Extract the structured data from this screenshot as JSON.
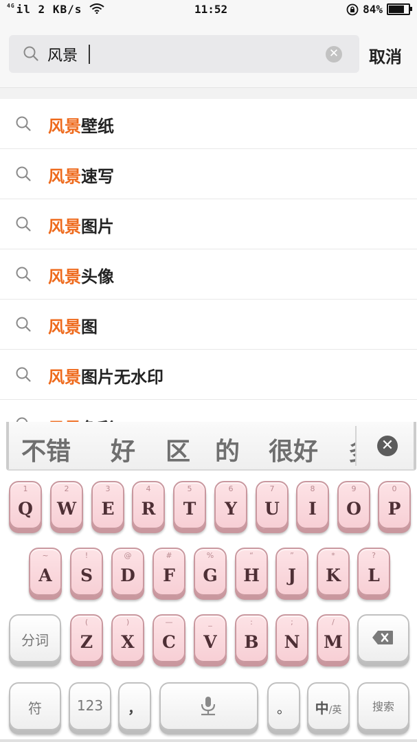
{
  "status_bar": {
    "network_type": "4G",
    "signal": "il",
    "speed": "2 KB/s",
    "time": "11:52",
    "battery": "84%",
    "battery_level": 0.84
  },
  "search": {
    "query": "风景",
    "cancel_label": "取消"
  },
  "suggestions": [
    {
      "highlight": "风景",
      "rest": "壁纸"
    },
    {
      "highlight": "风景",
      "rest": "速写"
    },
    {
      "highlight": "风景",
      "rest": "图片"
    },
    {
      "highlight": "风景",
      "rest": "头像"
    },
    {
      "highlight": "风景",
      "rest": "图"
    },
    {
      "highlight": "风景",
      "rest": "图片无水印"
    },
    {
      "highlight": "风景",
      "rest": "色彩"
    }
  ],
  "keyboard": {
    "candidates": [
      "不错",
      "好",
      "区",
      "的",
      "很好",
      "多"
    ],
    "row1": [
      {
        "main": "Q",
        "hint": "1"
      },
      {
        "main": "W",
        "hint": "2"
      },
      {
        "main": "E",
        "hint": "3"
      },
      {
        "main": "R",
        "hint": "4"
      },
      {
        "main": "T",
        "hint": "5"
      },
      {
        "main": "Y",
        "hint": "6"
      },
      {
        "main": "U",
        "hint": "7"
      },
      {
        "main": "I",
        "hint": "8"
      },
      {
        "main": "O",
        "hint": "9"
      },
      {
        "main": "P",
        "hint": "0"
      }
    ],
    "row2": [
      {
        "main": "A",
        "hint": "~"
      },
      {
        "main": "S",
        "hint": "!"
      },
      {
        "main": "D",
        "hint": "@"
      },
      {
        "main": "F",
        "hint": "#"
      },
      {
        "main": "G",
        "hint": "%"
      },
      {
        "main": "H",
        "hint": "“"
      },
      {
        "main": "J",
        "hint": "”"
      },
      {
        "main": "K",
        "hint": "*"
      },
      {
        "main": "L",
        "hint": "?"
      }
    ],
    "row3": [
      {
        "main": "Z",
        "hint": "("
      },
      {
        "main": "X",
        "hint": ")"
      },
      {
        "main": "C",
        "hint": "—"
      },
      {
        "main": "V",
        "hint": "_"
      },
      {
        "main": "B",
        "hint": ":"
      },
      {
        "main": "N",
        "hint": ";"
      },
      {
        "main": "M",
        "hint": "/"
      }
    ],
    "split_label": "分词",
    "symbol_label": "符",
    "numbers_label": "123",
    "comma_label": "，",
    "period_label": "。",
    "lang_zh": "中",
    "lang_en": "/英",
    "search_label": "搜索"
  },
  "colors": {
    "highlight": "#ee6a1c",
    "key_pink": "#f7cfd5"
  }
}
